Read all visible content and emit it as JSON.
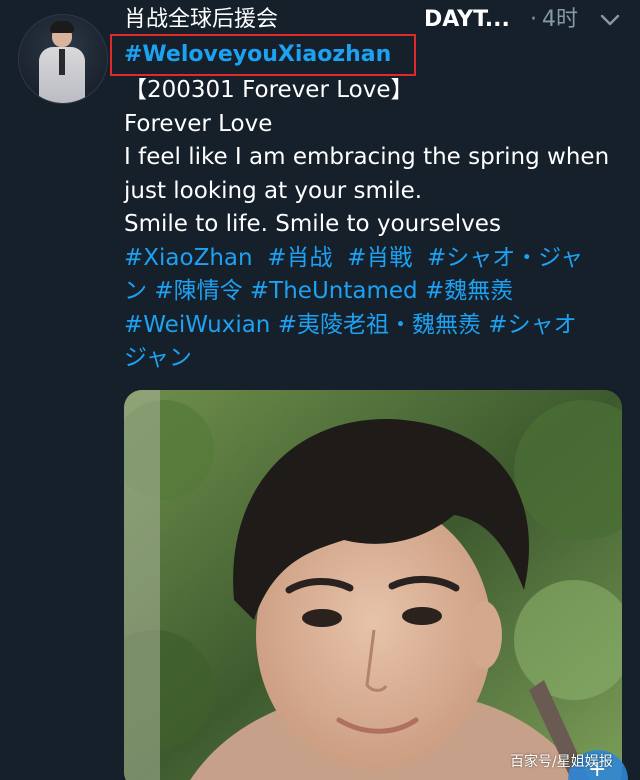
{
  "tweet": {
    "author_name": "肖战全球后援会",
    "handle": "DAYT...",
    "separator": "·",
    "timestamp": "4时",
    "highlighted_hashtag": "#WeloveyouXiaozhan",
    "lines": [
      {
        "segments": [
          {
            "text": "【200301 Forever Love】",
            "tag": false
          }
        ]
      },
      {
        "segments": [
          {
            "text": "Forever Love",
            "tag": false
          }
        ]
      },
      {
        "segments": [
          {
            "text": "I feel like I am embracing the spring when",
            "tag": false
          }
        ]
      },
      {
        "segments": [
          {
            "text": "just looking at your smile.",
            "tag": false
          }
        ]
      },
      {
        "segments": [
          {
            "text": "Smile to life. Smile to yourselves",
            "tag": false
          }
        ]
      },
      {
        "segments": [
          {
            "text": "#XiaoZhan",
            "tag": true
          },
          {
            "text": "  ",
            "tag": false
          },
          {
            "text": "#肖战",
            "tag": true
          },
          {
            "text": "  ",
            "tag": false
          },
          {
            "text": "#肖戦",
            "tag": true
          },
          {
            "text": "  ",
            "tag": false
          },
          {
            "text": "#シャオ・ジャ",
            "tag": true
          }
        ]
      },
      {
        "segments": [
          {
            "text": "ン",
            "tag": true
          },
          {
            "text": " ",
            "tag": false
          },
          {
            "text": "#陳情令",
            "tag": true
          },
          {
            "text": " ",
            "tag": false
          },
          {
            "text": "#TheUntamed",
            "tag": true
          },
          {
            "text": " ",
            "tag": false
          },
          {
            "text": "#魏無羨",
            "tag": true
          }
        ]
      },
      {
        "segments": [
          {
            "text": "#WeiWuxian",
            "tag": true
          },
          {
            "text": " ",
            "tag": false
          },
          {
            "text": "#夷陵老祖・魏無羨",
            "tag": true
          },
          {
            "text": " ",
            "tag": false
          },
          {
            "text": "#シャオ",
            "tag": true
          }
        ]
      },
      {
        "segments": [
          {
            "text": "ジャン",
            "tag": true
          }
        ]
      }
    ]
  },
  "icons": {
    "avatar": "avatar-photo",
    "menu": "chevron-down-icon",
    "photo": "tweet-photo"
  },
  "watermark": "百家号/星姐娱报",
  "colors": {
    "background": "#15202b",
    "link": "#1da1f2",
    "muted": "#8899a6",
    "highlight_border": "#e0292b"
  }
}
